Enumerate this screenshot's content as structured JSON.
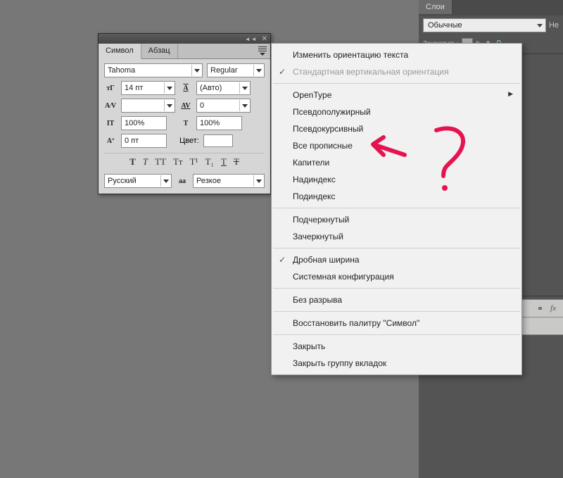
{
  "right_panel": {
    "tab": "Слои",
    "mode_select": "Обычные",
    "truncated_label": "Не",
    "lock_label": "Закрепить:"
  },
  "char_panel": {
    "tabs": {
      "symbol": "Символ",
      "paragraph": "Абзац"
    },
    "font_family": "Tahoma",
    "font_style": "Regular",
    "font_size": "14 пт",
    "leading": "(Авто)",
    "tracking_field": "",
    "kerning": "0",
    "v_scale": "100%",
    "h_scale": "100%",
    "baseline": "0 пт",
    "color_label": "Цвет:",
    "styles": {
      "bold": "T",
      "italic": "T",
      "allcaps": "TT",
      "smallcaps": "Tт",
      "superscript": "T¹",
      "subscript": "T₁",
      "underline": "T",
      "strike": "T"
    },
    "language": "Русский",
    "aa_prefix": "aа",
    "antialias": "Резкое"
  },
  "menu": {
    "change_orientation": "Изменить ориентацию текста",
    "std_vertical": "Стандартная вертикальная ориентация",
    "opentype": "OpenType",
    "faux_bold": "Псевдополужирный",
    "faux_italic": "Псевдокурсивный",
    "all_caps": "Все прописные",
    "small_caps": "Капители",
    "superscript": "Надиндекс",
    "subscript": "Подиндекс",
    "underline": "Подчеркнутый",
    "strike": "Зачеркнутый",
    "fractional": "Дробная ширина",
    "system_layout": "Системная конфигурация",
    "no_break": "Без разрыва",
    "reset": "Восстановить палитру \"Символ\"",
    "close": "Закрыть",
    "close_group": "Закрыть группу вкладок"
  }
}
